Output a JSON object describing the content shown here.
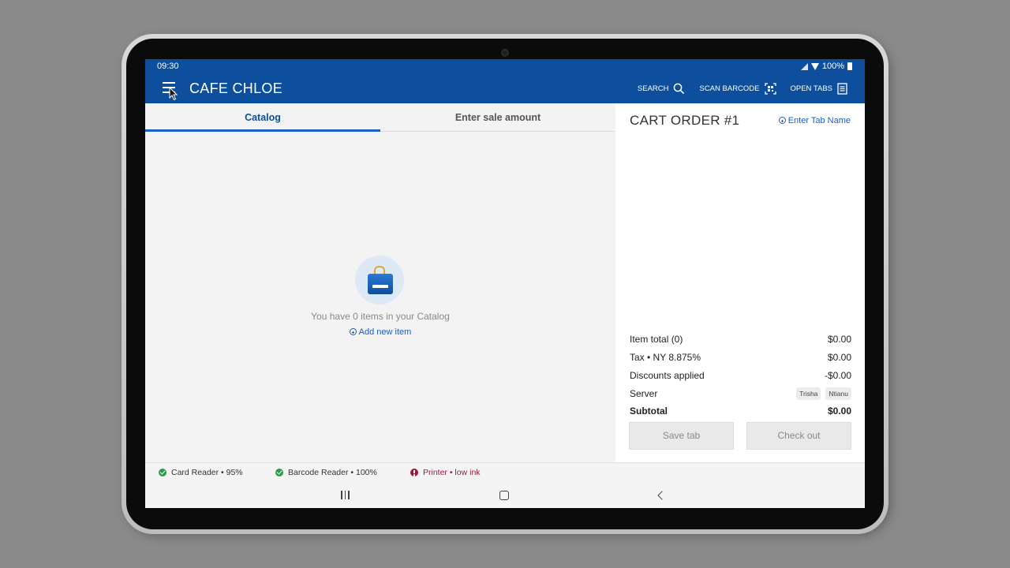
{
  "status_bar": {
    "time": "09:30",
    "battery": "100%"
  },
  "app_bar": {
    "title": "CAFE CHLOE",
    "actions": {
      "search": "SEARCH",
      "scan_barcode": "SCAN BARCODE",
      "open_tabs": "OPEN TABS"
    }
  },
  "catalog": {
    "tabs": {
      "catalog": "Catalog",
      "enter_sale": "Enter sale amount"
    },
    "active_tab": "Catalog",
    "empty_message": "You have 0 items in your Catalog",
    "add_item_label": "Add new item"
  },
  "cart": {
    "title": "CART ORDER #1",
    "enter_tab_name": "Enter Tab Name",
    "rows": {
      "item_total": {
        "label": "Item total (0)",
        "value": "$0.00"
      },
      "tax": {
        "label": "Tax •  NY 8.875%",
        "value": "$0.00"
      },
      "discounts": {
        "label": "Discounts applied",
        "value": "-$0.00"
      },
      "server": {
        "label": "Server",
        "chips": [
          "Trisha",
          "Ntianu"
        ]
      },
      "subtotal": {
        "label": "Subtotal",
        "value": "$0.00"
      }
    },
    "buttons": {
      "save_tab": "Save tab",
      "check_out": "Check out"
    }
  },
  "devices": {
    "card_reader": "Card Reader • 95%",
    "barcode_reader": "Barcode Reader • 100%",
    "printer": "Printer • low ink"
  },
  "colors": {
    "brand_blue": "#0d4f9c",
    "link_blue": "#1a5fc4",
    "ok_green": "#2b9a4a",
    "alert_red": "#9b1b3a"
  }
}
